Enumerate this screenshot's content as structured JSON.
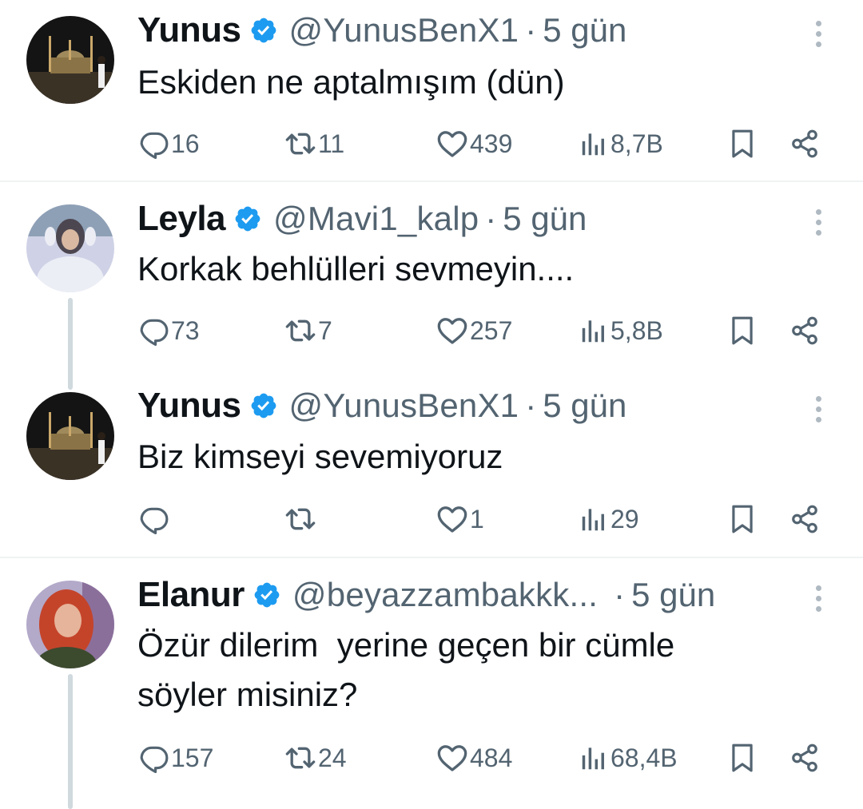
{
  "colors": {
    "verified_blue": "#1d9bf0",
    "text_primary": "#0f1419",
    "text_secondary": "#536471",
    "thread_line": "#cfd9de",
    "divider": "#eff3f4"
  },
  "icons": {
    "reply": "reply-icon",
    "retweet": "retweet-icon",
    "like": "heart-icon",
    "views": "views-icon",
    "bookmark": "bookmark-icon",
    "share": "share-icon",
    "more": "more-options-icon",
    "verified": "verified-badge-icon"
  },
  "tweets": [
    {
      "name": "Yunus",
      "handle": "@YunusBenX1",
      "separator": "·",
      "time": "5 gün",
      "text": "Eskiden ne aptalmışım (dün)",
      "replies": "16",
      "retweets": "11",
      "likes": "439",
      "views": "8,7B"
    },
    {
      "name": "Leyla",
      "handle": "@Mavi1_kalp",
      "separator": "·",
      "time": "5 gün",
      "text": "Korkak behlülleri sevmeyin....",
      "replies": "73",
      "retweets": "7",
      "likes": "257",
      "views": "5,8B"
    },
    {
      "name": "Yunus",
      "handle": "@YunusBenX1",
      "separator": "·",
      "time": "5 gün",
      "text": "Biz kimseyi sevemiyoruz",
      "replies": "",
      "retweets": "",
      "likes": "1",
      "views": "29"
    },
    {
      "name": "Elanur",
      "handle": "@beyazzambakkk...",
      "separator": "·",
      "time": "5 gün",
      "text": "Özür dilerim  yerine geçen bir cümle\nsöyler misiniz?",
      "replies": "157",
      "retweets": "24",
      "likes": "484",
      "views": "68,4B"
    }
  ]
}
